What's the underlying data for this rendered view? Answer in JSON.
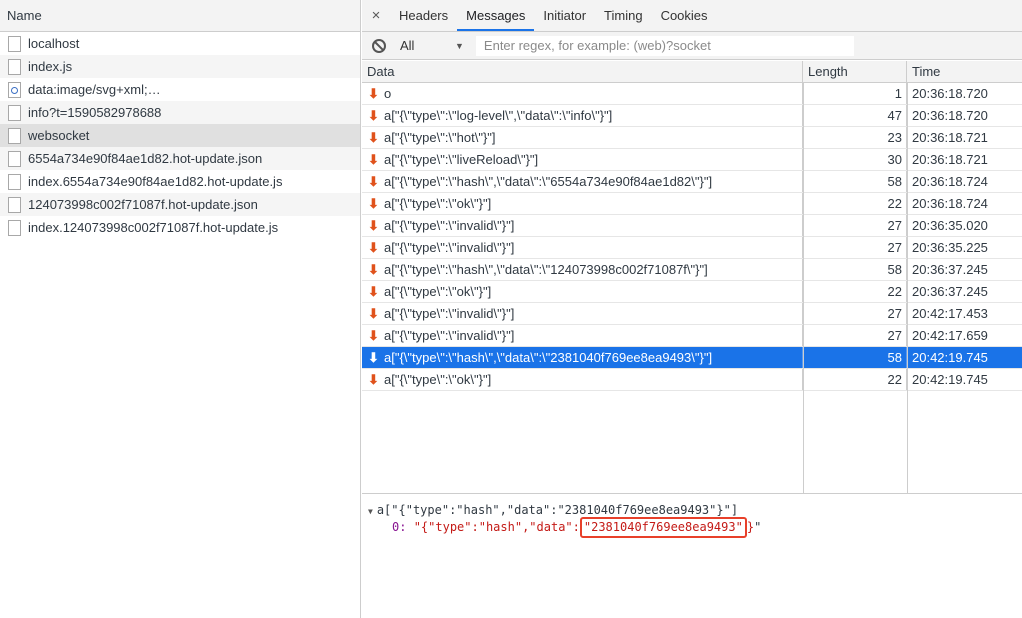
{
  "left_panel": {
    "header": "Name",
    "requests": [
      {
        "label": "localhost",
        "icon": "document-icon"
      },
      {
        "label": "index.js",
        "icon": "document-icon"
      },
      {
        "label": "data:image/svg+xml;…",
        "icon": "image-icon"
      },
      {
        "label": "info?t=1590582978688",
        "icon": "document-icon"
      },
      {
        "label": "websocket",
        "icon": "document-icon"
      },
      {
        "label": "6554a734e90f84ae1d82.hot-update.json",
        "icon": "document-icon"
      },
      {
        "label": "index.6554a734e90f84ae1d82.hot-update.js",
        "icon": "document-icon"
      },
      {
        "label": "124073998c002f71087f.hot-update.json",
        "icon": "document-icon"
      },
      {
        "label": "index.124073998c002f71087f.hot-update.js",
        "icon": "document-icon"
      }
    ]
  },
  "tabs": {
    "close": "×",
    "items": [
      "Headers",
      "Messages",
      "Initiator",
      "Timing",
      "Cookies"
    ],
    "active": "Messages"
  },
  "filter": {
    "select_value": "All",
    "placeholder": "Enter regex, for example: (web)?socket"
  },
  "table": {
    "headers": {
      "data": "Data",
      "length": "Length",
      "time": "Time"
    },
    "rows": [
      {
        "data": "o",
        "length": "1",
        "time": "20:36:18.720"
      },
      {
        "data": "a[\"{\\\"type\\\":\\\"log-level\\\",\\\"data\\\":\\\"info\\\"}\"]",
        "length": "47",
        "time": "20:36:18.720"
      },
      {
        "data": "a[\"{\\\"type\\\":\\\"hot\\\"}\"]",
        "length": "23",
        "time": "20:36:18.721"
      },
      {
        "data": "a[\"{\\\"type\\\":\\\"liveReload\\\"}\"]",
        "length": "30",
        "time": "20:36:18.721"
      },
      {
        "data": "a[\"{\\\"type\\\":\\\"hash\\\",\\\"data\\\":\\\"6554a734e90f84ae1d82\\\"}\"]",
        "length": "58",
        "time": "20:36:18.724"
      },
      {
        "data": "a[\"{\\\"type\\\":\\\"ok\\\"}\"]",
        "length": "22",
        "time": "20:36:18.724"
      },
      {
        "data": "a[\"{\\\"type\\\":\\\"invalid\\\"}\"]",
        "length": "27",
        "time": "20:36:35.020"
      },
      {
        "data": "a[\"{\\\"type\\\":\\\"invalid\\\"}\"]",
        "length": "27",
        "time": "20:36:35.225"
      },
      {
        "data": "a[\"{\\\"type\\\":\\\"hash\\\",\\\"data\\\":\\\"124073998c002f71087f\\\"}\"]",
        "length": "58",
        "time": "20:36:37.245"
      },
      {
        "data": "a[\"{\\\"type\\\":\\\"ok\\\"}\"]",
        "length": "22",
        "time": "20:36:37.245"
      },
      {
        "data": "a[\"{\\\"type\\\":\\\"invalid\\\"}\"]",
        "length": "27",
        "time": "20:42:17.453"
      },
      {
        "data": "a[\"{\\\"type\\\":\\\"invalid\\\"}\"]",
        "length": "27",
        "time": "20:42:17.659"
      },
      {
        "data": "a[\"{\\\"type\\\":\\\"hash\\\",\\\"data\\\":\\\"2381040f769ee8ea9493\\\"}\"]",
        "length": "58",
        "time": "20:42:19.745",
        "selected": true
      },
      {
        "data": "a[\"{\\\"type\\\":\\\"ok\\\"}\"]",
        "length": "22",
        "time": "20:42:19.745"
      }
    ]
  },
  "detail": {
    "summary": "a[\"{\"type\":\"hash\",\"data\":\"2381040f769ee8ea9493\"}\"]",
    "index_label": "0:",
    "value_open": "\"",
    "value_prefix": "{\"type\":\"hash\",\"data\":",
    "value_highlight": "\"2381040f769ee8ea9493\"",
    "value_suffix": "}",
    "value_close": "\""
  },
  "colors": {
    "selection": "#1a73e8",
    "incoming_arrow": "#e0521c",
    "highlight_box": "#e8402a"
  }
}
